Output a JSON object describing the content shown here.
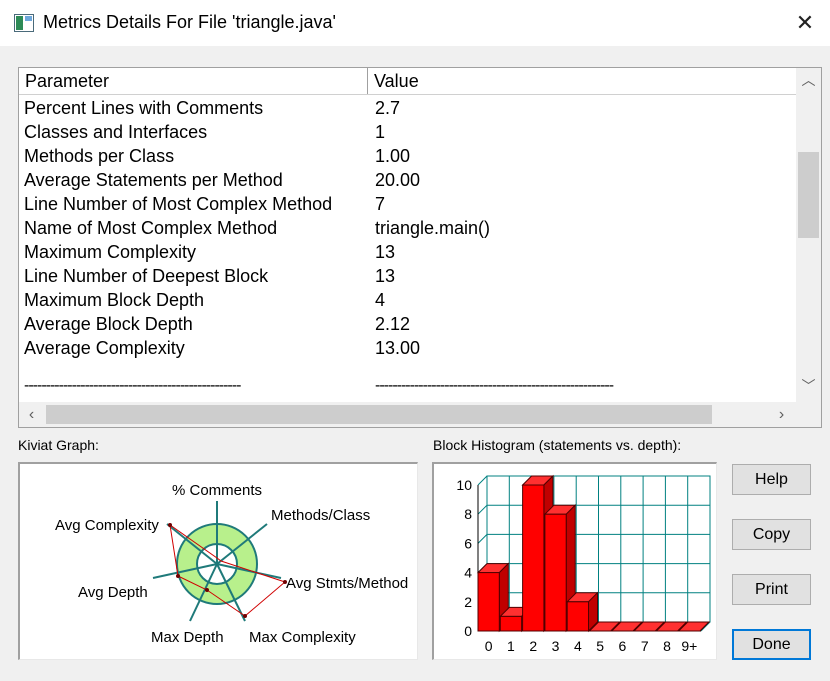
{
  "window": {
    "title": "Metrics Details For File 'triangle.java'",
    "close_glyph": "✕"
  },
  "table": {
    "header": {
      "param": "Parameter",
      "value": "Value"
    },
    "rows": [
      {
        "param": "Percent Lines with Comments",
        "value": "2.7"
      },
      {
        "param": "Classes and Interfaces",
        "value": "1"
      },
      {
        "param": "Methods per Class",
        "value": "1.00"
      },
      {
        "param": "Average Statements per Method",
        "value": "20.00"
      },
      {
        "param": "Line Number of Most Complex Method",
        "value": "7"
      },
      {
        "param": "Name of Most Complex Method",
        "value": "triangle.main()"
      },
      {
        "param": "Maximum Complexity",
        "value": "13"
      },
      {
        "param": "Line Number of Deepest Block",
        "value": "13"
      },
      {
        "param": "Maximum Block Depth",
        "value": "4"
      },
      {
        "param": "Average Block Depth",
        "value": "2.12"
      },
      {
        "param": "Average Complexity",
        "value": "13.00"
      }
    ],
    "dash1": "--------------------------------------------------",
    "dash2": "-------------------------------------------------------"
  },
  "kiviat": {
    "label": "Kiviat Graph:",
    "axes": {
      "comments": "% Comments",
      "methods": "Methods/Class",
      "stmts": "Avg Stmts/Method",
      "maxcomplex": "Max Complexity",
      "maxdepth": "Max Depth",
      "avgdepth": "Avg Depth",
      "avgcomplex": "Avg Complexity"
    }
  },
  "histogram": {
    "label": "Block Histogram (statements vs. depth):"
  },
  "chart_data": {
    "type": "bar",
    "title": "Block Histogram (statements vs. depth):",
    "categories": [
      "0",
      "1",
      "2",
      "3",
      "4",
      "5",
      "6",
      "7",
      "8",
      "9+"
    ],
    "values": [
      4,
      1,
      10,
      8,
      2,
      0,
      0,
      0,
      0,
      0
    ],
    "y_ticks": [
      "0",
      "2",
      "4",
      "6",
      "8",
      "10"
    ],
    "ylim": [
      0,
      10
    ],
    "grid": true,
    "bar_color": "#ff0000",
    "grid_color": "#008080"
  },
  "buttons": {
    "help": "Help",
    "copy": "Copy",
    "print": "Print",
    "done": "Done"
  },
  "colors": {
    "accent": "#0078d7",
    "ring": "#b8f08c"
  }
}
